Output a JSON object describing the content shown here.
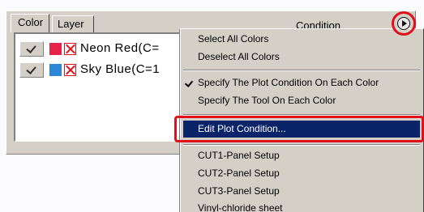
{
  "tabs": [
    {
      "label": "Color",
      "active": true
    },
    {
      "label": "Layer",
      "active": false
    }
  ],
  "header": {
    "condition_label": "Condition",
    "menu_button_icon": "play-circle-icon"
  },
  "colors": {
    "highlight_red": "#e2101b",
    "neon_red": "#e8234a",
    "sky_blue": "#2b87d6",
    "menu_selection": "#0a246a"
  },
  "list": {
    "items": [
      {
        "label": "Neon Red(C=",
        "checked": true,
        "swatch_color": "#e8234a"
      },
      {
        "label": "Sky Blue(C=1",
        "checked": true,
        "swatch_color": "#2b87d6"
      }
    ]
  },
  "menu": {
    "select_all": "Select All Colors",
    "deselect_all": "Deselect All Colors",
    "plot_each": "Specify The Plot Condition On Each Color",
    "tool_each": "Specify The Tool On Each Color",
    "edit_plot": "Edit Plot Condition...",
    "cut1": "CUT1-Panel Setup",
    "cut2": "CUT2-Panel Setup",
    "cut3": "CUT3-Panel Setup",
    "vinyl": "Vinyl-chloride sheet"
  }
}
